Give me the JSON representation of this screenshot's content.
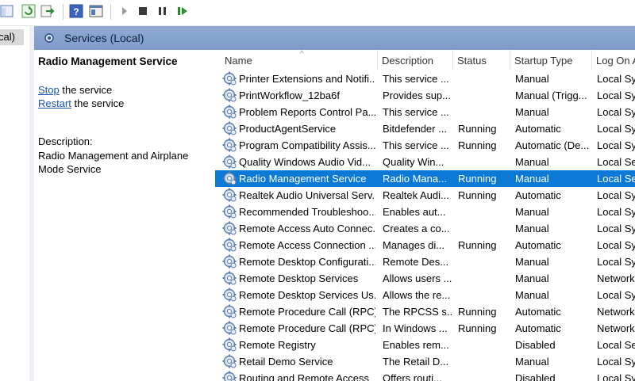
{
  "left_tree": {
    "item_label": "cal)"
  },
  "services_header": {
    "title": "Services (Local)"
  },
  "detail": {
    "service_name": "Radio Management Service",
    "stop_link": "Stop",
    "stop_suffix": "the service",
    "restart_link": "Restart",
    "restart_suffix": "the service",
    "description_label": "Description:",
    "description_text": "Radio Management and Airplane Mode Service"
  },
  "list": {
    "columns": [
      "Name",
      "Description",
      "Status",
      "Startup Type",
      "Log On As"
    ],
    "sort_indicator": "^",
    "selected_row": 6,
    "rows": [
      {
        "name": "Printer Extensions and Notifi...",
        "description": "This service ...",
        "status": "",
        "startup": "Manual",
        "logon": "Local Sys"
      },
      {
        "name": "PrintWorkflow_12ba6f",
        "description": "Provides sup...",
        "status": "",
        "startup": "Manual (Trigg...",
        "logon": "Local Sys"
      },
      {
        "name": "Problem Reports Control Pa...",
        "description": "This service ...",
        "status": "",
        "startup": "Manual",
        "logon": "Local Sys"
      },
      {
        "name": "ProductAgentService",
        "description": "Bitdefender ...",
        "status": "Running",
        "startup": "Automatic",
        "logon": "Local Sys"
      },
      {
        "name": "Program Compatibility Assis...",
        "description": "This service ...",
        "status": "Running",
        "startup": "Automatic (De...",
        "logon": "Local Sys"
      },
      {
        "name": "Quality Windows Audio Vid...",
        "description": "Quality Win...",
        "status": "",
        "startup": "Manual",
        "logon": "Local Ser"
      },
      {
        "name": "Radio Management Service",
        "description": "Radio Mana...",
        "status": "Running",
        "startup": "Manual",
        "logon": "Local Ser"
      },
      {
        "name": "Realtek Audio Universal Serv...",
        "description": "Realtek Audi...",
        "status": "Running",
        "startup": "Automatic",
        "logon": "Local Sys"
      },
      {
        "name": "Recommended Troubleshoo...",
        "description": "Enables aut...",
        "status": "",
        "startup": "Manual",
        "logon": "Local Sys"
      },
      {
        "name": "Remote Access Auto Connec...",
        "description": "Creates a co...",
        "status": "",
        "startup": "Manual",
        "logon": "Local Sys"
      },
      {
        "name": "Remote Access Connection ...",
        "description": "Manages di...",
        "status": "Running",
        "startup": "Automatic",
        "logon": "Local Sys"
      },
      {
        "name": "Remote Desktop Configurati...",
        "description": "Remote Des...",
        "status": "",
        "startup": "Manual",
        "logon": "Local Sys"
      },
      {
        "name": "Remote Desktop Services",
        "description": "Allows users ...",
        "status": "",
        "startup": "Manual",
        "logon": "Network"
      },
      {
        "name": "Remote Desktop Services Us...",
        "description": "Allows the re...",
        "status": "",
        "startup": "Manual",
        "logon": "Local Sys"
      },
      {
        "name": "Remote Procedure Call (RPC)",
        "description": "The RPCSS s...",
        "status": "Running",
        "startup": "Automatic",
        "logon": "Network"
      },
      {
        "name": "Remote Procedure Call (RPC)...",
        "description": "In Windows ...",
        "status": "Running",
        "startup": "Automatic",
        "logon": "Network"
      },
      {
        "name": "Remote Registry",
        "description": "Enables rem...",
        "status": "",
        "startup": "Disabled",
        "logon": "Local Ser"
      },
      {
        "name": "Retail Demo Service",
        "description": "The Retail D...",
        "status": "",
        "startup": "Manual",
        "logon": "Local Sys"
      },
      {
        "name": "Routing and Remote Access",
        "description": "Offers routi...",
        "status": "",
        "startup": "Disabled",
        "logon": "Local Sys"
      }
    ]
  },
  "toolbar": {
    "icons": [
      "show-hide-console-tree-icon",
      "refresh-icon",
      "export-list-icon",
      "help-icon",
      "properties-view-icon",
      "start-service-icon",
      "stop-service-icon",
      "pause-service-icon",
      "restart-service-icon"
    ]
  },
  "colors": {
    "header_blue": "#8fa9d2",
    "selection_blue": "#0c79d6",
    "link_blue": "#1a55b0"
  }
}
